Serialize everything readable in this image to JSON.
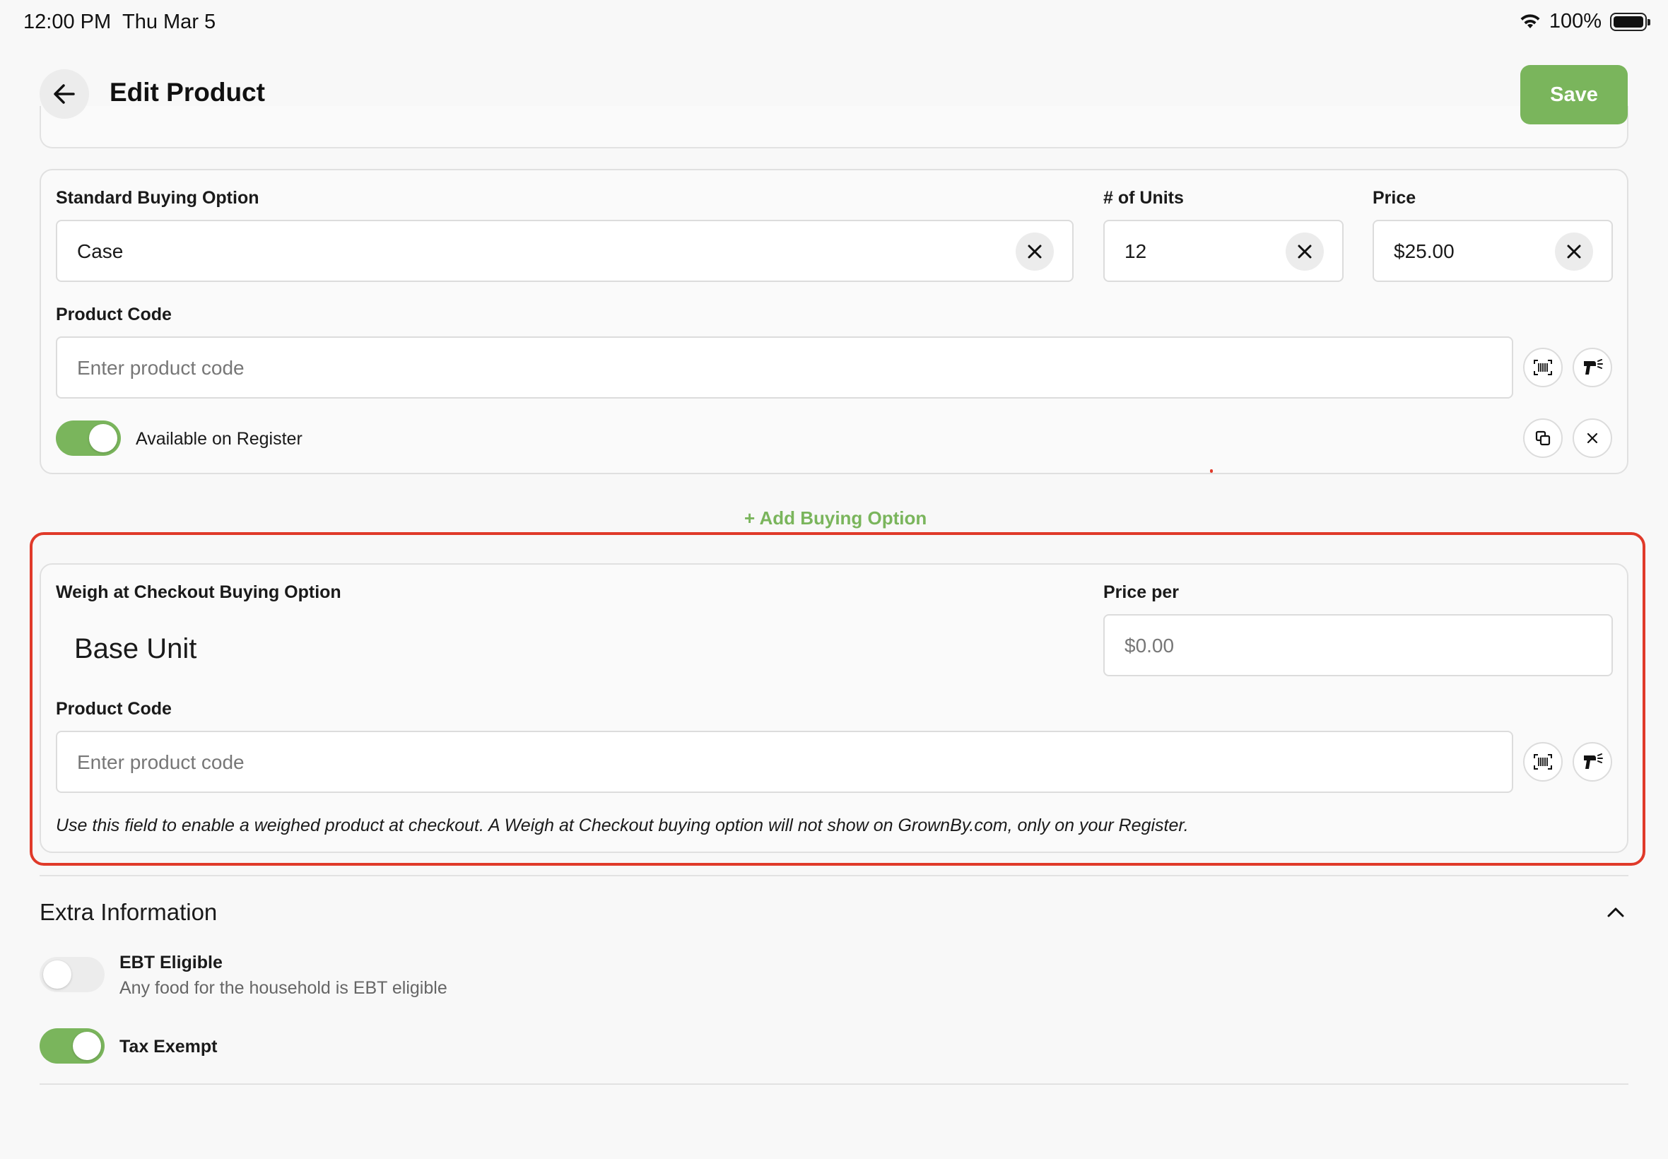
{
  "status_bar": {
    "time": "12:00 PM",
    "date": "Thu Mar 5",
    "battery": "100%"
  },
  "header": {
    "title": "Edit Product",
    "save_label": "Save"
  },
  "standard_option": {
    "label": "Standard Buying Option",
    "value": "Case",
    "units_label": "# of Units",
    "units_value": "12",
    "price_label": "Price",
    "price_value": "$25.00",
    "product_code_label": "Product Code",
    "product_code_placeholder": "Enter product code",
    "available_label": "Available on Register",
    "available_on": true
  },
  "add_option_label": "+ Add Buying Option",
  "weigh_option": {
    "label": "Weigh at Checkout Buying Option",
    "unit": "Base Unit",
    "price_per_label": "Price per",
    "price_per_placeholder": "$0.00",
    "product_code_label": "Product Code",
    "product_code_placeholder": "Enter product code",
    "hint": "Use this field to enable a weighed product at checkout. A Weigh at Checkout buying option will not show on GrownBy.com, only on your Register."
  },
  "extra": {
    "title": "Extra Information",
    "ebt_label": "EBT Eligible",
    "ebt_desc": "Any food for the household is EBT eligible",
    "ebt_on": false,
    "tax_label": "Tax Exempt",
    "tax_on": true
  },
  "colors": {
    "accent": "#7ab55c",
    "highlight": "#e03a2a"
  }
}
